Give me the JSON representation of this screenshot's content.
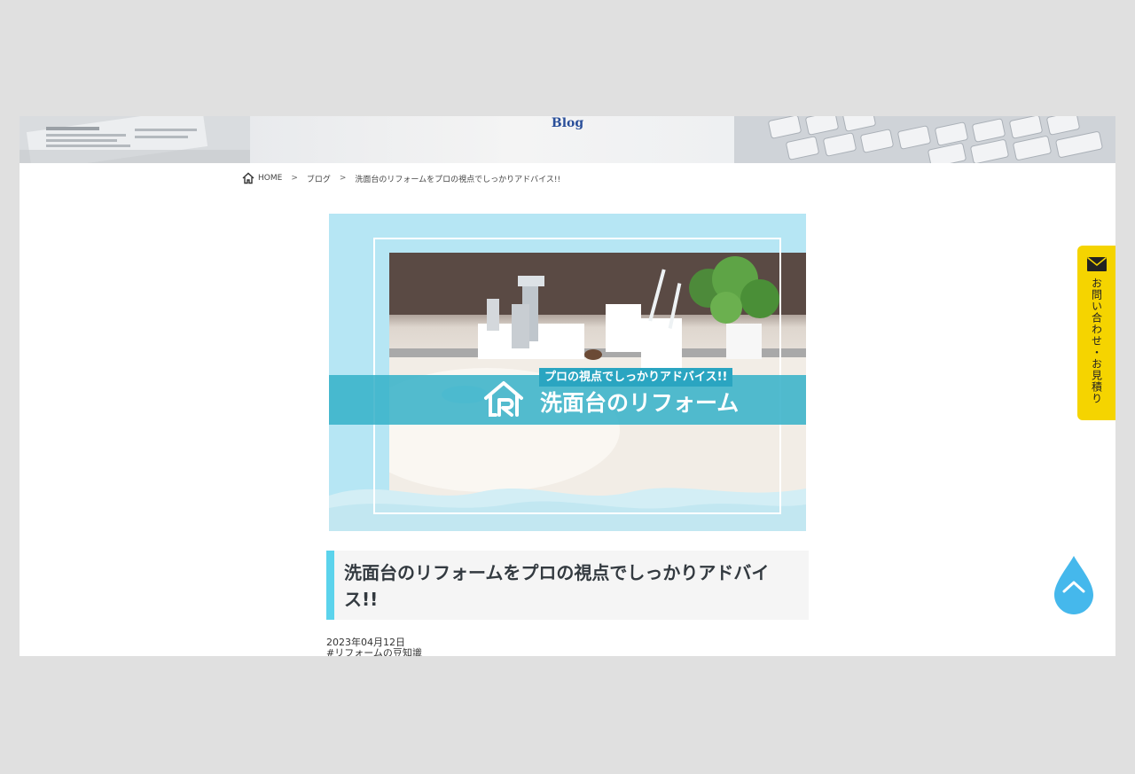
{
  "hero": {
    "title": "Blog"
  },
  "breadcrumb": {
    "home": "HOME",
    "blog": "ブログ",
    "current": "洗面台のリフォームをプロの視点でしっかりアドバイス!!"
  },
  "eyecatch": {
    "tag": "プロの視点でしっかりアドバイス!!",
    "title": "洗面台のリフォーム"
  },
  "post": {
    "title": "洗面台のリフォームをプロの視点でしっかりアドバイス!!",
    "date": "2023年04月12日",
    "tag": "#リフォームの豆知識"
  },
  "contact": {
    "label": "お問い合わせ・お見積り"
  },
  "colors": {
    "accent": "#5bd3ec",
    "contact_bg": "#f5d400",
    "totop": "#45b8ec",
    "hero_title": "#2a4f9a"
  }
}
